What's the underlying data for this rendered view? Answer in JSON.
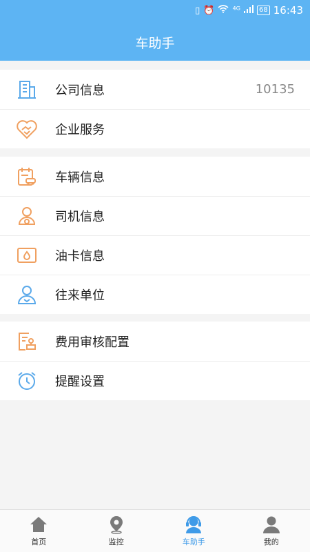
{
  "status_bar": {
    "signal": "⁴ᴳ",
    "battery": "68",
    "time": "16:43"
  },
  "header": {
    "title": "车助手"
  },
  "groups": [
    {
      "items": [
        {
          "label": "公司信息",
          "value": "10135"
        },
        {
          "label": "企业服务"
        }
      ]
    },
    {
      "items": [
        {
          "label": "车辆信息"
        },
        {
          "label": "司机信息"
        },
        {
          "label": "油卡信息"
        },
        {
          "label": "往来单位"
        }
      ]
    },
    {
      "items": [
        {
          "label": "费用审核配置"
        },
        {
          "label": "提醒设置"
        }
      ]
    }
  ],
  "tabbar": {
    "items": [
      {
        "label": "首页",
        "icon": "home-icon"
      },
      {
        "label": "监控",
        "icon": "location-pin-icon"
      },
      {
        "label": "车助手",
        "icon": "assistant-icon"
      },
      {
        "label": "我的",
        "icon": "user-icon"
      }
    ],
    "active_index": 2
  },
  "colors": {
    "header_bg": "#5db4f3",
    "icon_blue": "#5aa9ea",
    "icon_orange": "#f0a060",
    "active_tab": "#3f9be8"
  }
}
